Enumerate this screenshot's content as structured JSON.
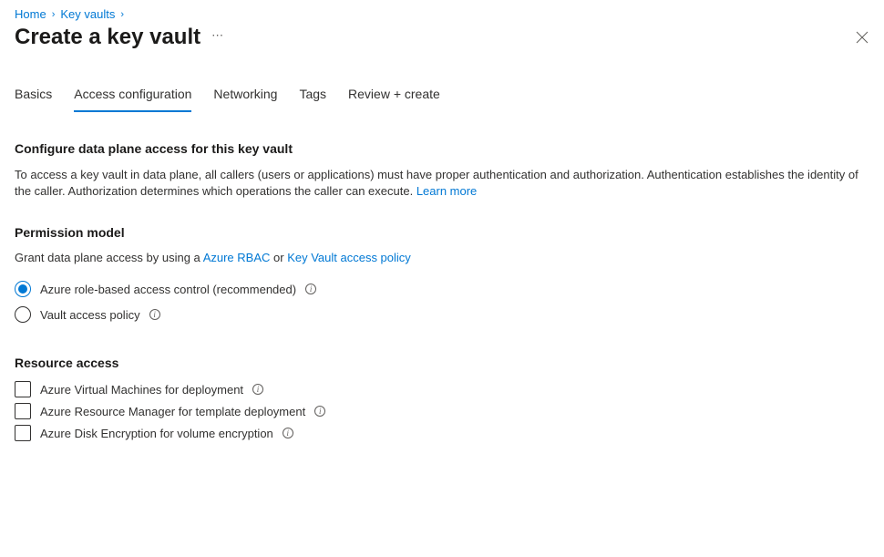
{
  "breadcrumb": {
    "home": "Home",
    "keyvaults": "Key vaults"
  },
  "page": {
    "title": "Create a key vault"
  },
  "tabs": {
    "basics": "Basics",
    "access_config": "Access configuration",
    "networking": "Networking",
    "tags": "Tags",
    "review": "Review + create"
  },
  "section1": {
    "heading": "Configure data plane access for this key vault",
    "desc": "To access a key vault in data plane, all callers (users or applications) must have proper authentication and authorization. Authentication establishes the identity of the caller. Authorization determines which operations the caller can execute. ",
    "learn_more": "Learn more"
  },
  "permission_model": {
    "heading": "Permission model",
    "intro_prefix": "Grant data plane access by using a ",
    "link_rbac": "Azure RBAC",
    "intro_or": " or ",
    "link_policy": "Key Vault access policy",
    "options": {
      "rbac": "Azure role-based access control (recommended)",
      "vault_policy": "Vault access policy"
    }
  },
  "resource_access": {
    "heading": "Resource access",
    "options": {
      "vms": "Azure Virtual Machines for deployment",
      "arm": "Azure Resource Manager for template deployment",
      "disk": "Azure Disk Encryption for volume encryption"
    }
  }
}
